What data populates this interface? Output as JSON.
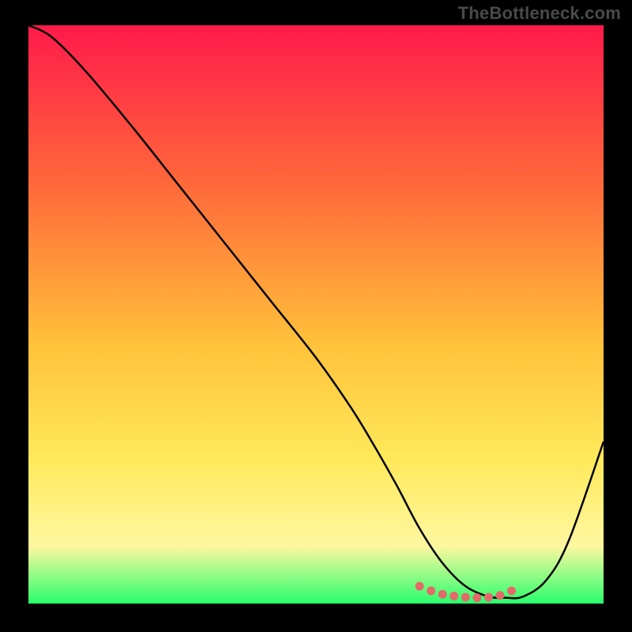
{
  "watermark": "TheBottleneck.com",
  "colors": {
    "page_bg": "#000000",
    "grad_top": "#ff1a4b",
    "grad_mid1": "#ff6a3a",
    "grad_mid2": "#ffc13a",
    "grad_mid3": "#ffe95a",
    "grad_mid4": "#fff7a0",
    "grad_bottom": "#29ff6d",
    "curve_stroke": "#000000",
    "marker_fill": "#e46a6a"
  },
  "chart_data": {
    "type": "line",
    "title": "",
    "xlabel": "",
    "ylabel": "",
    "xlim": [
      0,
      100
    ],
    "ylim": [
      0,
      100
    ],
    "series": [
      {
        "name": "curve",
        "x": [
          0,
          4,
          10,
          18,
          26,
          34,
          42,
          50,
          56,
          60,
          64,
          68,
          72,
          76,
          80,
          83,
          86,
          90,
          94,
          100
        ],
        "y": [
          100,
          98,
          92,
          82.5,
          72.5,
          62.5,
          52.5,
          42.5,
          34,
          27.5,
          20.5,
          13,
          7,
          3,
          1.2,
          1.0,
          1.2,
          4,
          11,
          28
        ]
      }
    ],
    "markers": {
      "name": "valley-markers",
      "x": [
        68,
        70,
        72,
        74,
        76,
        78,
        80,
        82,
        84
      ],
      "y": [
        3.0,
        2.2,
        1.6,
        1.3,
        1.1,
        1.0,
        1.1,
        1.4,
        2.2
      ]
    }
  }
}
